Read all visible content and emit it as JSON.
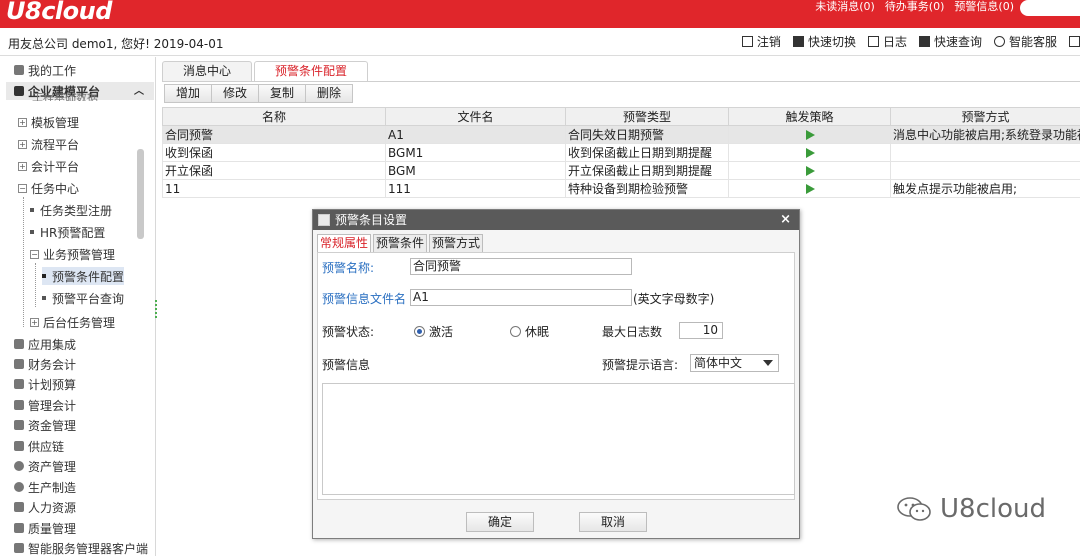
{
  "app": {
    "logo": "U8cloud",
    "top_links": [
      "未读消息(0)",
      "待办事务(0)",
      "预警信息(0)"
    ],
    "welcome": "用友总公司 demo1, 您好! 2019-04-01",
    "actions": [
      "注销",
      "快速切换",
      "日志",
      "快速查询",
      "智能客服"
    ]
  },
  "sidebar": {
    "my_work": "我的工作",
    "platform": "企业建模平台",
    "partial_item": "工程基础数据",
    "items": [
      {
        "label": "模板管理",
        "type": "plus"
      },
      {
        "label": "流程平台",
        "type": "plus"
      },
      {
        "label": "会计平台",
        "type": "plus"
      },
      {
        "label": "任务中心",
        "type": "minus"
      },
      {
        "label": "任务类型注册",
        "type": "leaf"
      },
      {
        "label": "HR预警配置",
        "type": "leaf"
      },
      {
        "label": "业务预警管理",
        "type": "minus"
      },
      {
        "label": "预警条件配置",
        "type": "leaf"
      },
      {
        "label": "预警平台查询",
        "type": "leaf"
      },
      {
        "label": "后台任务管理",
        "type": "plus"
      }
    ],
    "modules": [
      "应用集成",
      "财务会计",
      "计划预算",
      "管理会计",
      "资金管理",
      "供应链",
      "资产管理",
      "生产制造",
      "人力资源",
      "质量管理",
      "智能服务管理器客户端"
    ]
  },
  "tabs": [
    "消息中心",
    "预警条件配置"
  ],
  "toolbar": [
    "增加",
    "修改",
    "复制",
    "删除"
  ],
  "grid": {
    "headers": [
      "名称",
      "文件名",
      "预警类型",
      "触发策略",
      "预警方式"
    ],
    "rows": [
      [
        "合同预警",
        "A1",
        "合同失效日期预警",
        "play",
        "消息中心功能被启用;系统登录功能被启"
      ],
      [
        "收到保函",
        "BGM1",
        "收到保函截止日期到期提醒",
        "play",
        ""
      ],
      [
        "开立保函",
        "BGM",
        "开立保函截止日期到期提醒",
        "play",
        ""
      ],
      [
        "11",
        "111",
        "特种设备到期检验预警",
        "play",
        "触发点提示功能被启用;"
      ]
    ]
  },
  "dialog": {
    "title": "预警条目设置",
    "close": "×",
    "tabs": [
      "常规属性",
      "预警条件",
      "预警方式"
    ],
    "name_label": "预警名称:",
    "name_value": "合同预警",
    "file_label": "预警信息文件名",
    "file_value": "A1",
    "file_hint": "(英文字母数字)",
    "status_label": "预警状态:",
    "status_active": "激活",
    "status_sleep": "休眠",
    "max_log_label": "最大日志数",
    "max_log_value": "10",
    "info_label": "预警信息",
    "lang_label": "预警提示语言:",
    "lang_value": "简体中文",
    "ok": "确定",
    "cancel": "取消"
  },
  "watermark": "U8cloud",
  "colors": {
    "brand_red": "#e0262b",
    "accent_red": "#d9232a",
    "link_blue": "#2a6fc1",
    "play_green": "#3a9b3a"
  }
}
